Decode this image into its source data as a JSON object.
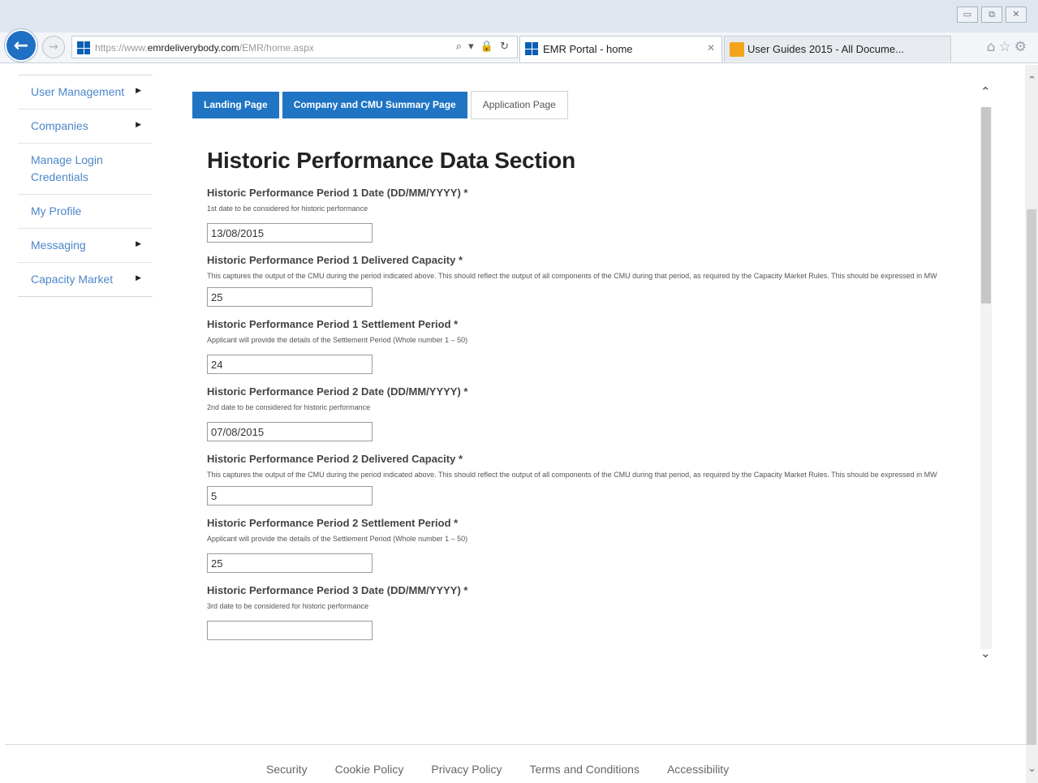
{
  "browser": {
    "url_prefix": "https://www.",
    "url_domain": "emrdeliverybody.com",
    "url_path": "/EMR/home.aspx",
    "address_tools": "⌕ ▾ 🔒 ↻",
    "tabs": [
      {
        "label": "EMR Portal - home",
        "close": "✕"
      },
      {
        "label": "User Guides 2015 - All Docume..."
      }
    ],
    "window_controls": [
      "▭",
      "⧉",
      "✕"
    ],
    "icons": [
      "home-icon",
      "star-icon",
      "settings-icon"
    ]
  },
  "sidebar": {
    "items": [
      {
        "label": "User Management",
        "has_submenu": true
      },
      {
        "label": "Companies",
        "has_submenu": true
      },
      {
        "label": "Manage Login Credentials",
        "has_submenu": false
      },
      {
        "label": "My Profile",
        "has_submenu": false
      },
      {
        "label": "Messaging",
        "has_submenu": true
      },
      {
        "label": "Capacity Market",
        "has_submenu": true
      }
    ]
  },
  "tabs": {
    "landing": "Landing Page",
    "company": "Company and CMU Summary Page",
    "application": "Application Page"
  },
  "section": {
    "title": "Historic Performance Data Section",
    "fields": [
      {
        "label": "Historic Performance Period 1 Date (DD/MM/YYYY) *",
        "help": "1st date to be considered for historic performance",
        "value": "13/08/2015"
      },
      {
        "label": "Historic Performance Period 1 Delivered Capacity *",
        "help": "This captures the output of the CMU during the period indicated above. This should reflect the output of all components of the CMU during that period, as required by the Capacity Market Rules. This should be expressed in MW",
        "value": "25"
      },
      {
        "label": "Historic Performance Period 1 Settlement Period *",
        "help": "Applicant will provide the details of the Settlement Period (Whole number 1 – 50)",
        "value": "24"
      },
      {
        "label": "Historic Performance Period 2 Date (DD/MM/YYYY) *",
        "help": "2nd date to be considered for historic performance",
        "value": "07/08/2015"
      },
      {
        "label": "Historic Performance Period 2 Delivered Capacity *",
        "help": "This captures the output of the CMU during the period indicated above. This should reflect the output of all components of the CMU during that period, as required by the Capacity Market Rules. This should be expressed in MW",
        "value": "5"
      },
      {
        "label": "Historic Performance Period 2 Settlement Period *",
        "help": "Applicant will provide the details of the Settlement Period (Whole number 1 – 50)",
        "value": "25"
      },
      {
        "label": "Historic Performance Period 3 Date (DD/MM/YYYY) *",
        "help": "3rd date to be considered for historic performance",
        "value": ""
      }
    ]
  },
  "footer": {
    "links": [
      "Security",
      "Cookie Policy",
      "Privacy Policy",
      "Terms and Conditions",
      "Accessibility"
    ]
  },
  "colors": {
    "accent": "#1f74c3",
    "link": "#4b86c8"
  }
}
